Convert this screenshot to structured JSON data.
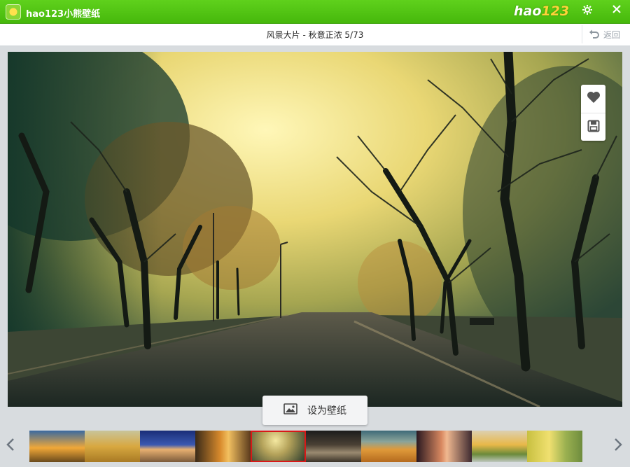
{
  "app": {
    "title": "hao123小熊壁纸",
    "brand": "hao",
    "brand_num": "123"
  },
  "header": {
    "title": "风景大片 - 秋意正浓 5/73",
    "back_label": "返回"
  },
  "actions": {
    "set_wallpaper_label": "设为壁纸"
  },
  "icons": [
    "app-logo-icon",
    "settings-icon",
    "close-icon",
    "back-icon",
    "heart-icon",
    "save-icon",
    "image-icon",
    "chevron-left-icon",
    "chevron-right-icon"
  ],
  "colors": {
    "titlebar": "#4cbf12",
    "active_thumb_border": "#d81818"
  },
  "filmstrip": {
    "count": 10,
    "active_index": 4
  }
}
